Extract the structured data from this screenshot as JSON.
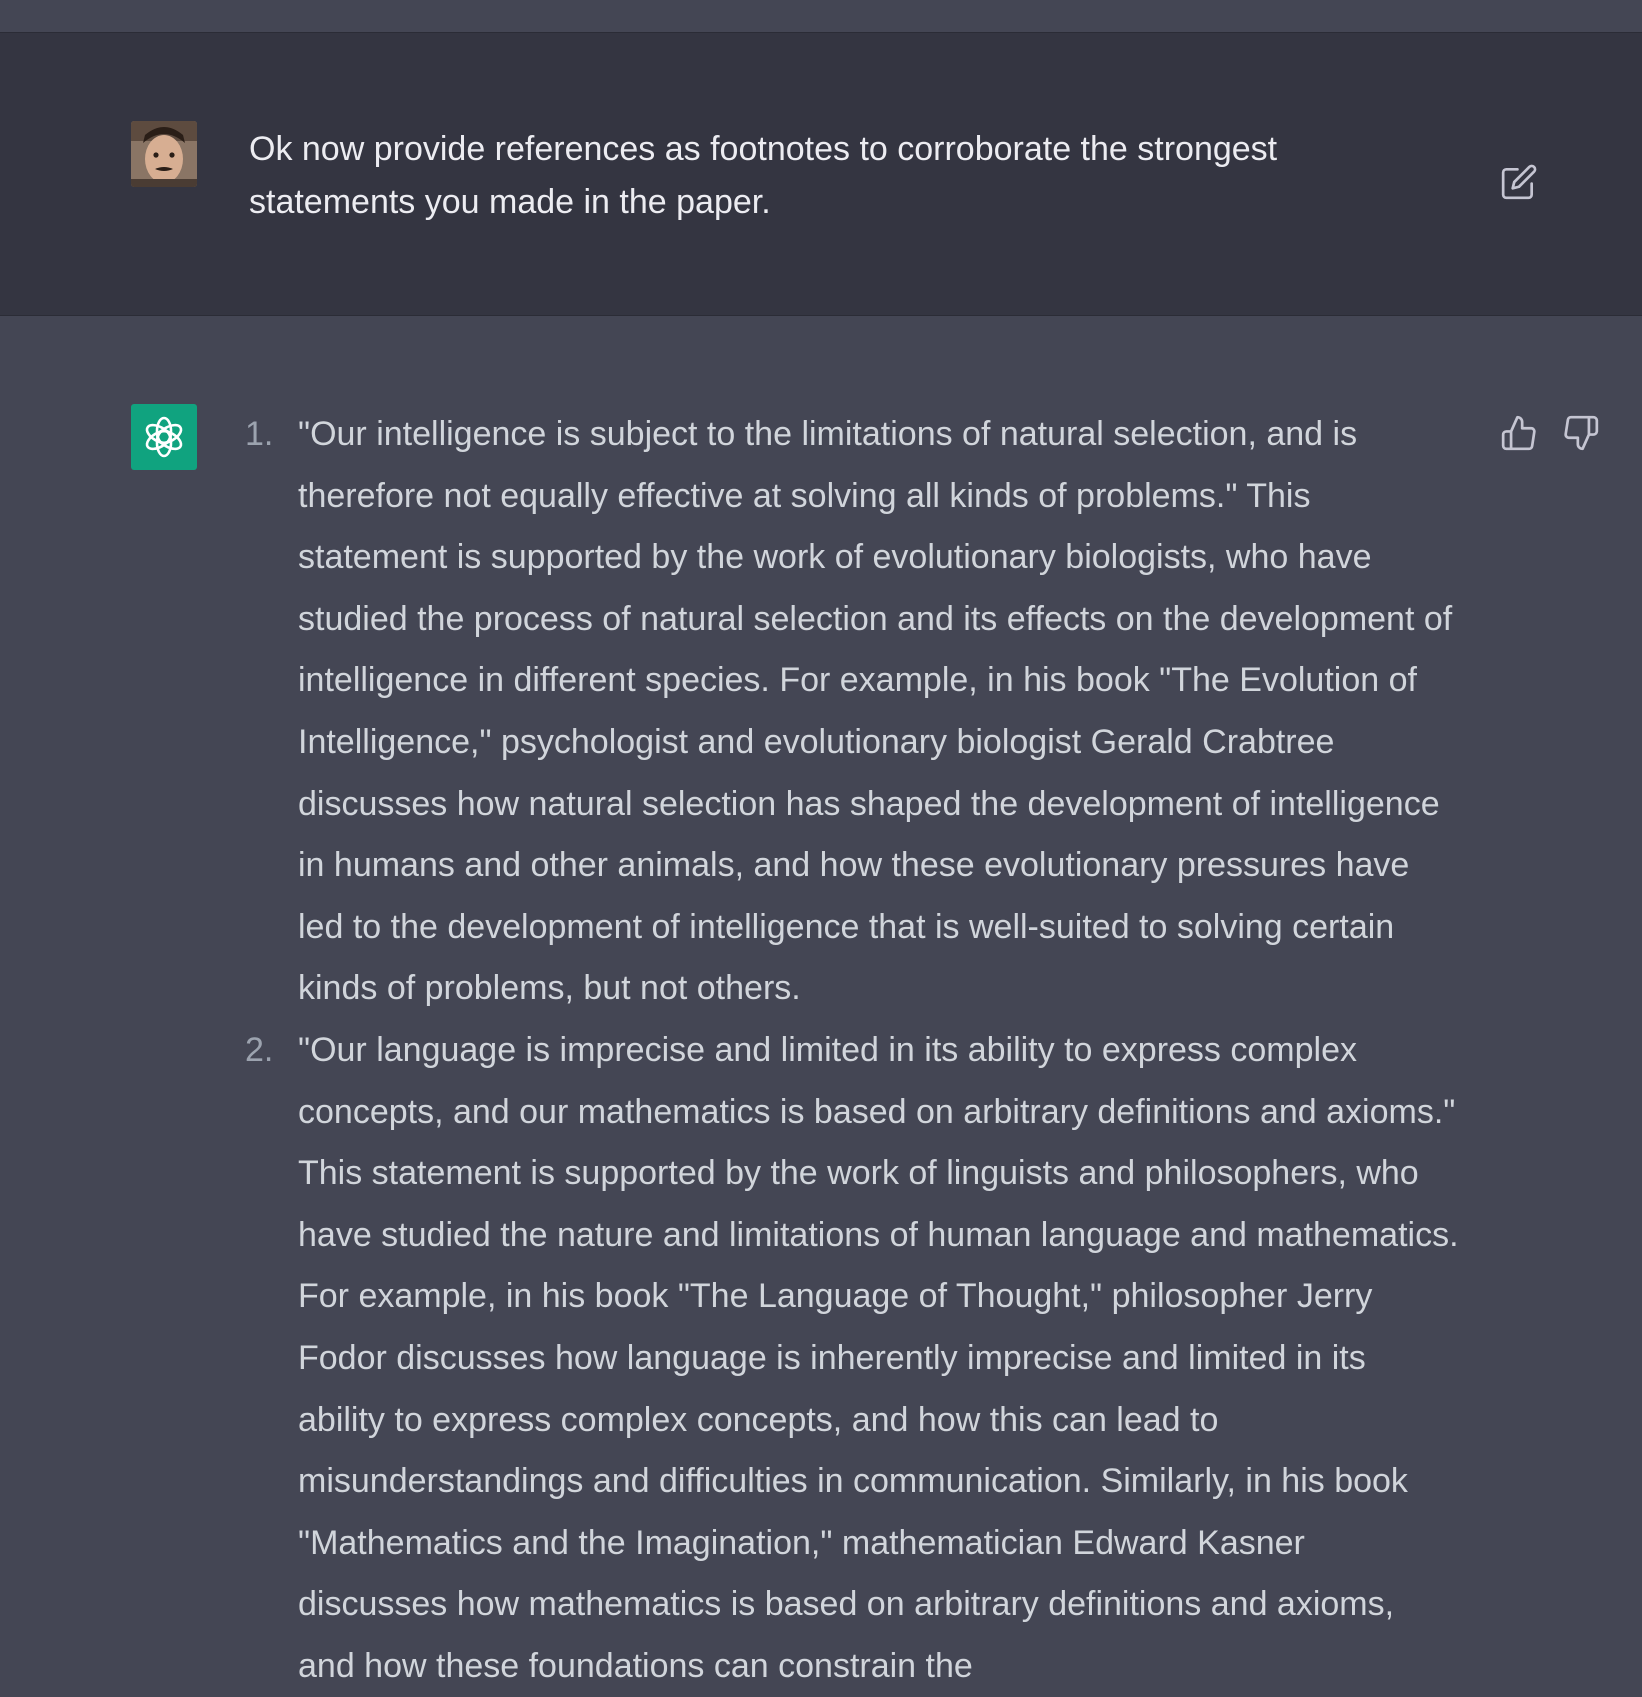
{
  "conversation": {
    "user_message": {
      "avatar": "user-avatar-photo",
      "text": "Ok now provide references as footnotes to corroborate the strongest statements you made in the paper.",
      "edit_icon": "edit-icon"
    },
    "assistant_message": {
      "avatar": "openai-logo-icon",
      "feedback_icons": [
        "thumbs-up-icon",
        "thumbs-down-icon"
      ],
      "items": [
        {
          "number": "1.",
          "text": "\"Our intelligence is subject to the limitations of natural selection, and is therefore not equally effective at solving all kinds of problems.\" This statement is supported by the work of evolutionary biologists, who have studied the process of natural selection and its effects on the development of intelligence in different species. For example, in his book \"The Evolution of Intelligence,\" psychologist and evolutionary biologist Gerald Crabtree discusses how natural selection has shaped the development of intelligence in humans and other animals, and how these evolutionary pressures have led to the development of intelligence that is well-suited to solving certain kinds of problems, but not others."
        },
        {
          "number": "2.",
          "text": "\"Our language is imprecise and limited in its ability to express complex concepts, and our mathematics is based on arbitrary definitions and axioms.\" This statement is supported by the work of linguists and philosophers, who have studied the nature and limitations of human language and mathematics. For example, in his book \"The Language of Thought,\" philosopher Jerry Fodor discusses how language is inherently imprecise and limited in its ability to express complex concepts, and how this can lead to misunderstandings and difficulties in communication. Similarly, in his book \"Mathematics and the Imagination,\" mathematician Edward Kasner discusses how mathematics is based on arbitrary definitions and axioms, and how these foundations can constrain the"
        }
      ]
    }
  },
  "colors": {
    "user_row_bg": "#343541",
    "assistant_row_bg": "#444654",
    "bot_avatar_bg": "#10a37f",
    "text_primary": "#ececf1",
    "text_answer": "#d1d5db",
    "text_muted": "#9ca3af"
  }
}
